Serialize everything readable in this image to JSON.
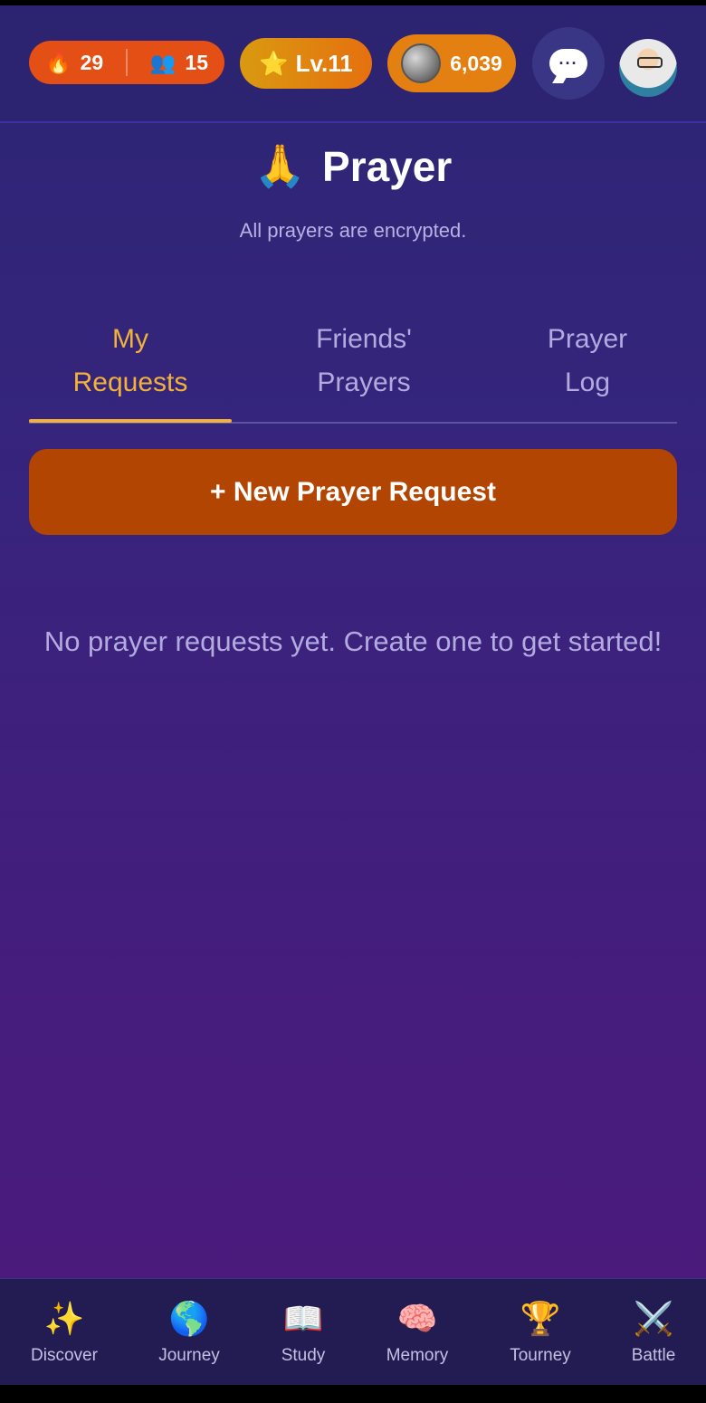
{
  "topbar": {
    "streak": "29",
    "friends": "15",
    "level": "Lv.11",
    "coins": "6,039",
    "icons": {
      "streak": "fire-icon",
      "friends": "friends-icon",
      "level": "star-icon",
      "coins": "coin-icon",
      "chat": "chat-bubble-icon",
      "avatar": "elder-avatar"
    }
  },
  "header": {
    "emoji": "🙏",
    "title": "Prayer",
    "subtitle": "All prayers are encrypted."
  },
  "tabs": [
    {
      "line1": "My",
      "line2": "Requests"
    },
    {
      "line1": "Friends'",
      "line2": "Prayers"
    },
    {
      "line1": "Prayer",
      "line2": "Log"
    }
  ],
  "new_request_label": "+ New Prayer Request",
  "empty_message": "No prayer requests yet. Create one to get started!",
  "nav": [
    {
      "label": "Discover",
      "icon": "✨"
    },
    {
      "label": "Journey",
      "icon": "🌎"
    },
    {
      "label": "Study",
      "icon": "📖"
    },
    {
      "label": "Memory",
      "icon": "🧠"
    },
    {
      "label": "Tourney",
      "icon": "🏆"
    },
    {
      "label": "Battle",
      "icon": "⚔️"
    }
  ],
  "colors": {
    "accent": "#f2b23a",
    "button": "#b34502",
    "streak_pill": "#e34f14",
    "coin_pill": "#e47f12"
  }
}
